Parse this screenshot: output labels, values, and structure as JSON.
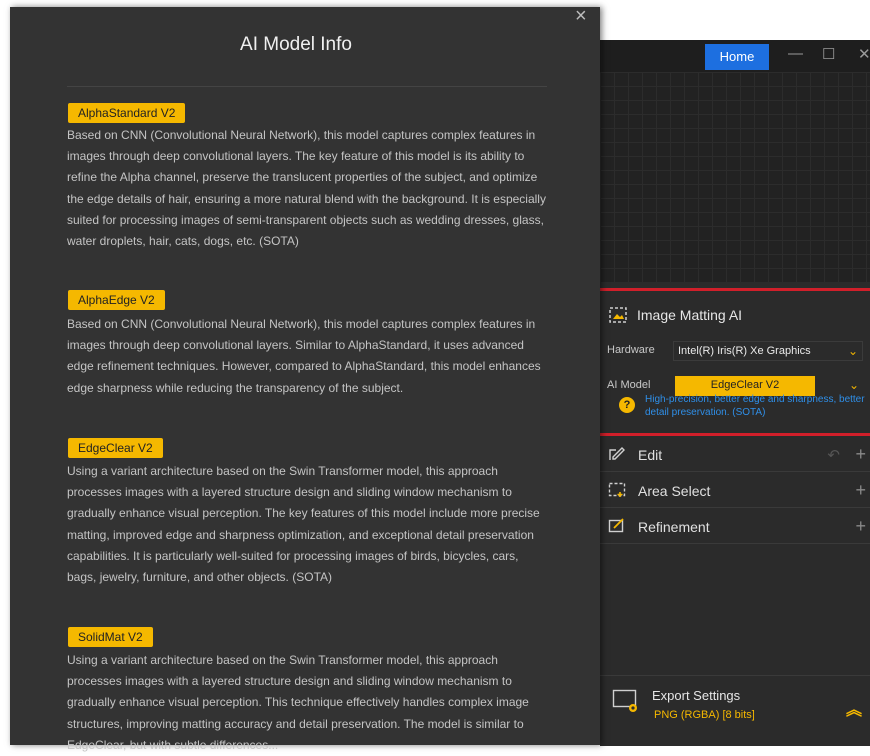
{
  "dialog": {
    "title": "AI Model Info",
    "close_glyph": "×",
    "models": [
      {
        "name": "AlphaStandard  V2",
        "description": "Based on CNN (Convolutional Neural Network), this model captures complex features in images through deep convolutional layers. The key feature of this model is its ability to refine the Alpha channel, preserve the translucent properties of the subject, and optimize the edge details of hair, ensuring a more natural blend with the background. It is especially suited for processing images of semi-transparent objects such as wedding dresses, glass, water droplets, hair, cats, dogs, etc. (SOTA)"
      },
      {
        "name": "AlphaEdge  V2",
        "description": "Based on CNN (Convolutional Neural Network), this model captures complex features in images through deep convolutional layers. Similar to AlphaStandard, it uses advanced edge refinement techniques. However, compared to AlphaStandard, this model enhances edge sharpness while reducing the transparency of the subject."
      },
      {
        "name": "EdgeClear  V2",
        "description": "Using a variant architecture based on the Swin Transformer model, this approach processes images with a layered structure design and sliding window mechanism to gradually enhance visual perception. The key features of this model include more precise matting, improved edge and sharpness optimization, and exceptional detail preservation capabilities. It is particularly well-suited for processing images of birds, bicycles, cars, bags, jewelry, furniture, and other objects. (SOTA)"
      },
      {
        "name": "SolidMat  V2",
        "description": "Using a variant architecture based on the Swin Transformer model, this approach processes images with a layered structure design and sliding window mechanism to gradually enhance visual perception. This technique effectively handles complex image structures, improving matting accuracy and detail preservation. The model is similar to EdgeClear, but with subtle differences..."
      }
    ]
  },
  "app": {
    "home_label": "Home",
    "window_controls": [
      "—",
      "☐",
      "✕"
    ],
    "matting": {
      "title": "Image Matting AI",
      "hardware_label": "Hardware",
      "hardware_value": "Intel(R) Iris(R) Xe Graphics",
      "model_label": "AI Model",
      "model_value": "EdgeClear  V2",
      "hint": "High-precision, better edge and sharpness, better detail preservation. (SOTA)"
    },
    "sections": [
      {
        "label": "Edit",
        "icon": "edit-icon"
      },
      {
        "label": "Area Select",
        "icon": "area-select-icon"
      },
      {
        "label": "Refinement",
        "icon": "refinement-icon"
      }
    ],
    "export": {
      "title": "Export Settings",
      "format": "PNG (RGBA) [8 bits]"
    }
  },
  "colors": {
    "accent_yellow": "#f5b800",
    "home_blue": "#1d6fe0",
    "highlight_red": "#d11f2a",
    "hint_blue": "#2f8fe8"
  }
}
